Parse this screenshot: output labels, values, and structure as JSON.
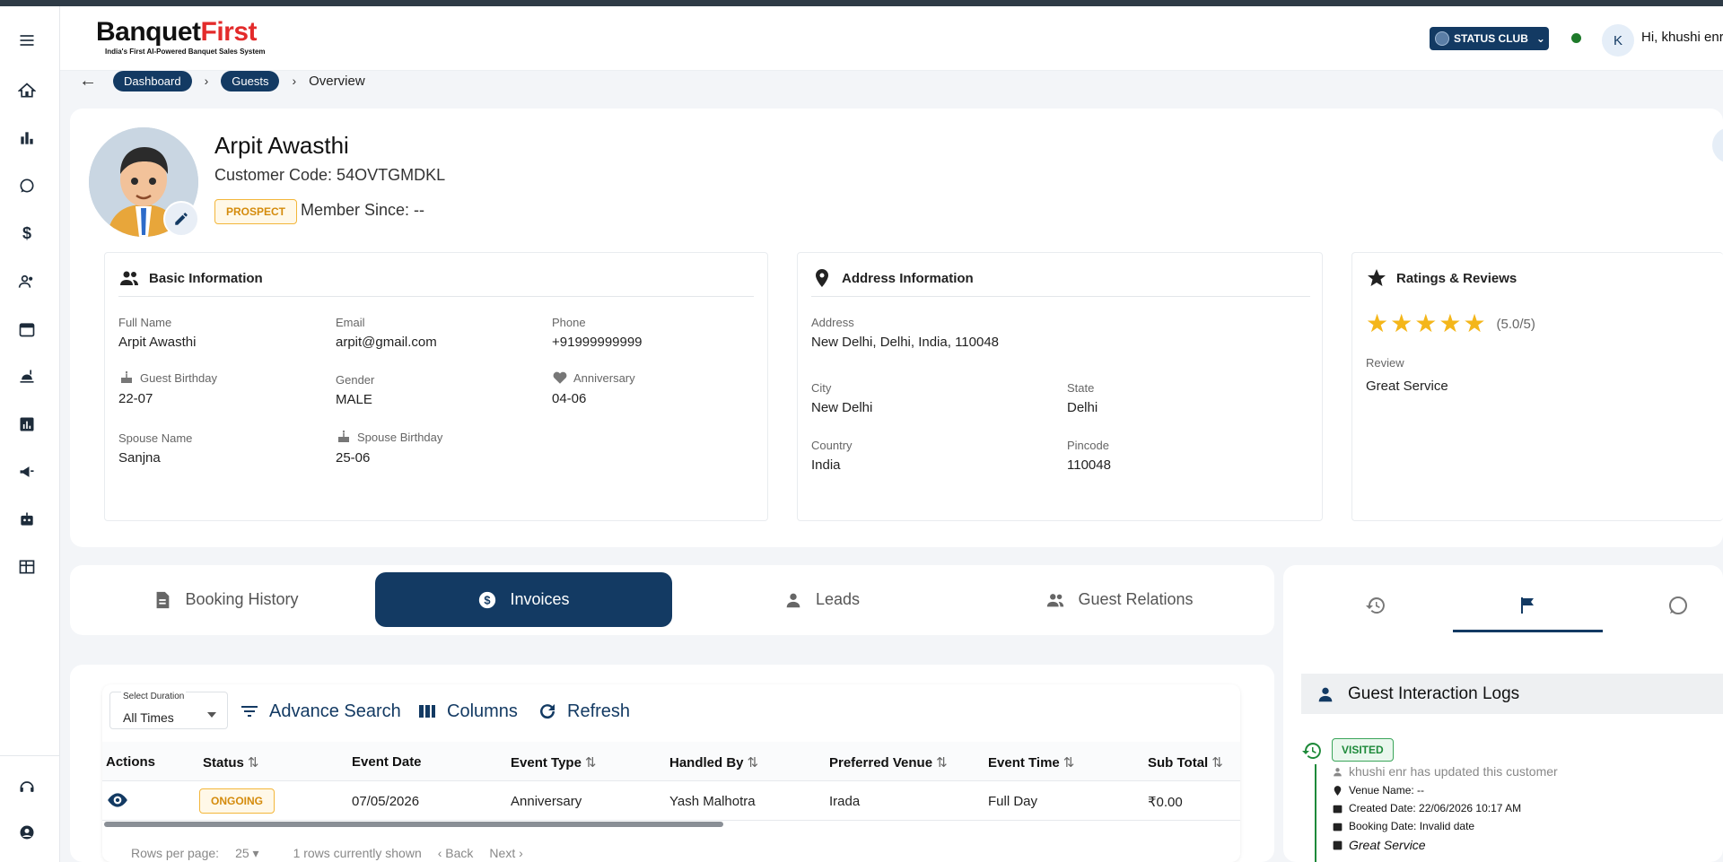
{
  "header": {
    "logo_main_left": "Banquet",
    "logo_main_right": "First",
    "logo_sub": "India's First AI-Powered Banquet Sales System",
    "club_label": "STATUS CLUB",
    "avatar_initial": "K",
    "greeting": "Hi,  khushi enr"
  },
  "sidebar": {
    "items": [
      "menu-icon",
      "home-icon",
      "bar-chart-icon",
      "whatsapp-icon",
      "dollar-icon",
      "people-icon",
      "calendar-icon",
      "food-icon",
      "report-icon",
      "megaphone-icon",
      "robot-icon",
      "table-icon",
      "support-icon",
      "account-icon"
    ]
  },
  "breadcrumb": {
    "items": [
      "Dashboard",
      "Guests"
    ],
    "current": "Overview"
  },
  "profile": {
    "name": "Arpit Awasthi",
    "customer_code": "Customer Code: 54OVTGMDKL",
    "badge": "PROSPECT",
    "member_since": "Member Since: --"
  },
  "basic_info": {
    "title": "Basic Information",
    "fields": {
      "full_name_label": "Full Name",
      "full_name": "Arpit Awasthi",
      "email_label": "Email",
      "email": "arpit@gmail.com",
      "phone_label": "Phone",
      "phone": "+91999999999",
      "birthday_label": "Guest Birthday",
      "birthday": "22-07",
      "gender_label": "Gender",
      "gender": "MALE",
      "anniversary_label": "Anniversary",
      "anniversary": "04-06",
      "spouse_label": "Spouse Name",
      "spouse": "Sanjna",
      "spouse_birthday_label": "Spouse Birthday",
      "spouse_birthday": "25-06"
    }
  },
  "address_info": {
    "title": "Address Information",
    "address_label": "Address",
    "address": "New Delhi, Delhi, India, 110048",
    "city_label": "City",
    "city": "New Delhi",
    "state_label": "State",
    "state": "Delhi",
    "country_label": "Country",
    "country": "India",
    "pincode_label": "Pincode",
    "pincode": "110048"
  },
  "ratings": {
    "title": "Ratings & Reviews",
    "stars": 5,
    "score_text": "(5.0/5)",
    "review_label": "Review",
    "review": "Great Service",
    "star_color": "#f4b61a"
  },
  "tabs": [
    {
      "label": "Booking History",
      "icon": "document-icon",
      "active": false
    },
    {
      "label": "Invoices",
      "icon": "dollar-circle-icon",
      "active": true
    },
    {
      "label": "Leads",
      "icon": "person-icon",
      "active": false
    },
    {
      "label": "Guest Relations",
      "icon": "people-icon",
      "active": false
    }
  ],
  "table": {
    "select_label": "Select Duration",
    "select_value": "All Times",
    "tools": {
      "advance_search": "Advance Search",
      "columns": "Columns",
      "refresh": "Refresh"
    },
    "headers": [
      "Actions",
      "Status",
      "Event Date",
      "Event Type",
      "Handled By",
      "Preferred Venue",
      "Event Time",
      "Sub Total"
    ],
    "sort_symbol": "⇅",
    "rows": [
      {
        "status": "ONGOING",
        "event_date": "07/05/2026",
        "event_type": "Anniversary",
        "handled_by": "Yash Malhotra",
        "venue": "Irada",
        "event_time": "Full Day",
        "sub_total": "₹0.00"
      }
    ],
    "pager": {
      "rows_label": "Rows per page:",
      "rows_value": "25",
      "shown": "1 rows currently shown",
      "back": "Back",
      "next": "Next"
    }
  },
  "logs": {
    "title": "Guest Interaction Logs",
    "badge": "VISITED",
    "updated": "khushi enr has updated this customer",
    "venue": "Venue Name: --",
    "created": "Created Date: 22/06/2026 10:17 AM",
    "booking": "Booking Date: Invalid date",
    "review": "Great Service"
  },
  "colors": {
    "brand": "#133a63",
    "accent_red": "#e32b2b",
    "status_green": "#1e7a2a",
    "badge_orange": "#d48b0c"
  }
}
